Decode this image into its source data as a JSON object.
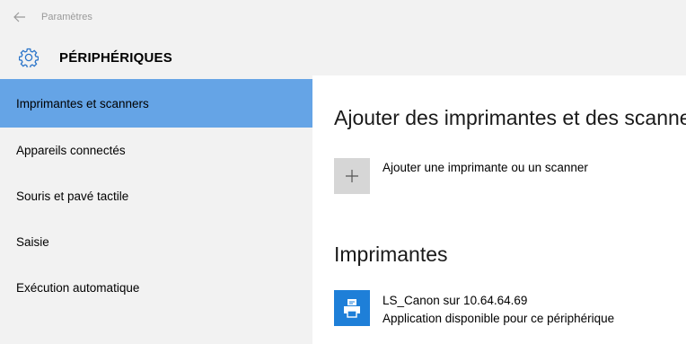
{
  "window": {
    "app_title": "Paramètres",
    "back_icon": "back-arrow-icon"
  },
  "header": {
    "icon": "gear-icon",
    "title": "PÉRIPHÉRIQUES"
  },
  "nav": {
    "items": [
      {
        "label": "Imprimantes et scanners",
        "selected": true
      },
      {
        "label": "Appareils connectés",
        "selected": false
      },
      {
        "label": "Souris et pavé tactile",
        "selected": false
      },
      {
        "label": "Saisie",
        "selected": false
      },
      {
        "label": "Exécution automatique",
        "selected": false
      }
    ]
  },
  "main": {
    "add_section_heading": "Ajouter des imprimantes et des scanners",
    "add_button_icon": "plus-icon",
    "add_button_label": "Ajouter une imprimante ou un scanner",
    "printers_heading": "Imprimantes",
    "printers": [
      {
        "icon": "printer-icon",
        "name": "LS_Canon sur 10.64.64.69",
        "status": "Application disponible pour ce périphérique"
      }
    ]
  },
  "colors": {
    "sidebar_bg": "#f2f2f2",
    "selected_bg": "#65a4e6",
    "accent": "#1e7fd8",
    "add_tile": "#d6d6d6"
  }
}
